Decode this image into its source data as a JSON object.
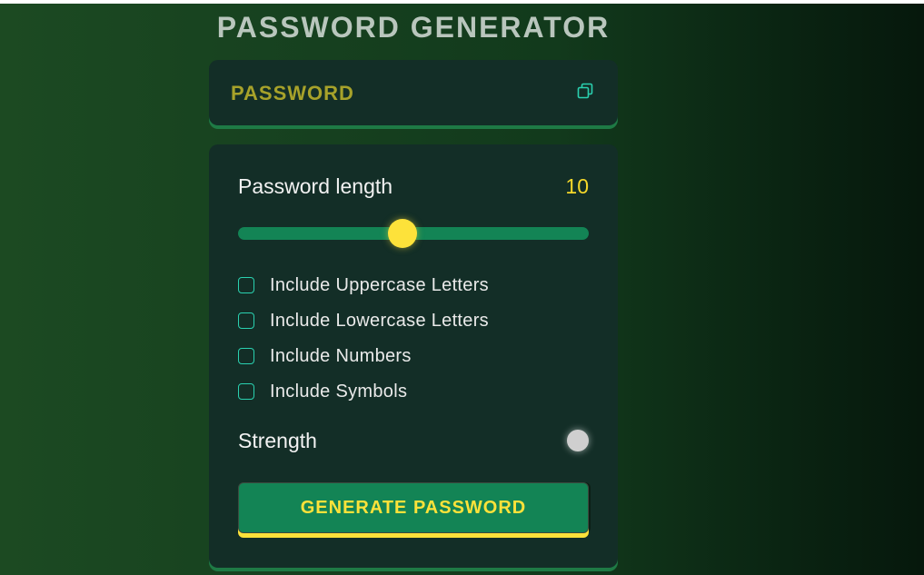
{
  "app": {
    "title": "PASSWORD GENERATOR"
  },
  "password_display": {
    "text": "PASSWORD",
    "copy_icon": "copy-icon"
  },
  "length": {
    "label": "Password length",
    "value": "10",
    "slider_fraction": 0.47
  },
  "options": [
    {
      "label": "Include Uppercase Letters",
      "checked": false
    },
    {
      "label": "Include Lowercase Letters",
      "checked": false
    },
    {
      "label": "Include Numbers",
      "checked": false
    },
    {
      "label": "Include Symbols",
      "checked": false
    }
  ],
  "strength": {
    "label": "Strength",
    "indicator_color": "#cfcfcf"
  },
  "generate_button": {
    "label": "GENERATE PASSWORD"
  },
  "colors": {
    "accent_yellow": "#fde23a",
    "accent_green": "#138455",
    "checkbox_border": "#2ad1b0",
    "card_bg": "#132e27"
  }
}
